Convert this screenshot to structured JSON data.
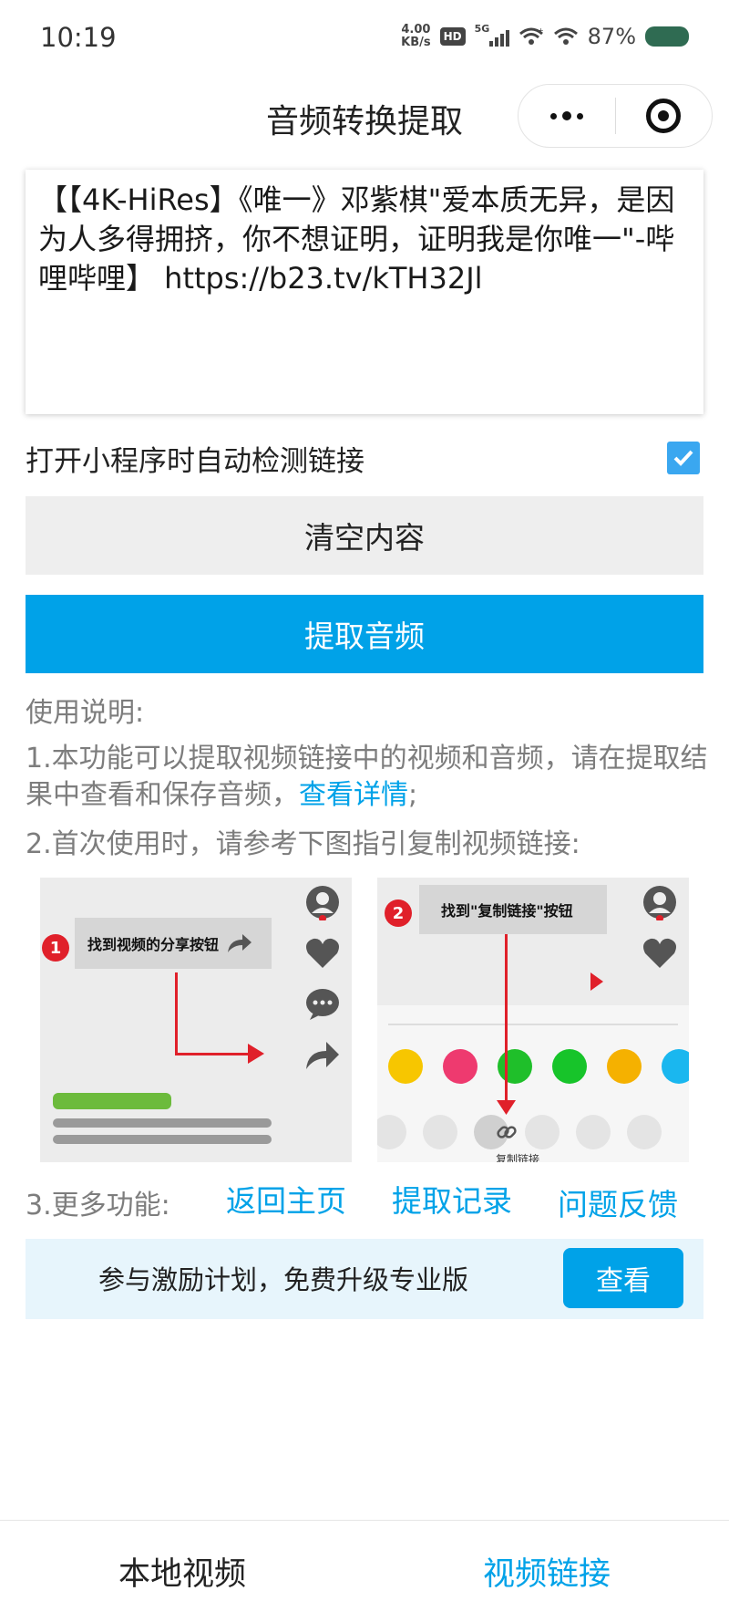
{
  "status_bar": {
    "time": "10:19",
    "net_speed_value": "4.00",
    "net_speed_unit": "KB/s",
    "hd_label": "HD",
    "network_label": "5G",
    "battery_percent": "87%",
    "battery_color": "#2f6b52"
  },
  "nav": {
    "title": "音频转换提取",
    "more_icon": "more-dots-icon",
    "close_icon": "target-circle-icon"
  },
  "input": {
    "link_text": "【【4K-HiRes】《唯一》邓紫棋\"爱本质无异，是因为人多得拥挤，你不想证明，证明我是你唯一\"-哔哩哔哩】 https://b23.tv/kTH32Jl"
  },
  "auto_detect": {
    "label": "打开小程序时自动检测链接",
    "checked": true
  },
  "buttons": {
    "clear": "清空内容",
    "extract": "提取音频"
  },
  "instructions": {
    "heading": "使用说明:",
    "item1_prefix": "1.本功能可以提取视频链接中的视频和音频，请在提取结果中查看和保存音频，",
    "item1_link": "查看详情",
    "item1_suffix": ";",
    "item2": "2.首次使用时，请参考下图指引复制视频链接:"
  },
  "guide": {
    "step1_num": "1",
    "step1_text": "找到视频的分享按钮",
    "step2_num": "2",
    "step2_text": "找到\"复制链接\"按钮",
    "copy_link_label": "复制链接",
    "share_colors": [
      "#f7c600",
      "#ee3a6f",
      "#1fbf2a",
      "#17c42a",
      "#f5b100",
      "#1ab7ef"
    ]
  },
  "more": {
    "label": "3.更多功能:",
    "home": "返回主页",
    "history": "提取记录",
    "feedback": "问题反馈"
  },
  "promo": {
    "text": "参与激励计划，免费升级专业版",
    "button": "查看"
  },
  "tabs": {
    "local": "本地视频",
    "link": "视频链接",
    "active": "link"
  },
  "colors": {
    "accent": "#00a2e8",
    "checkbox": "#3aa7f0",
    "guide_arrow": "#e0202a"
  }
}
